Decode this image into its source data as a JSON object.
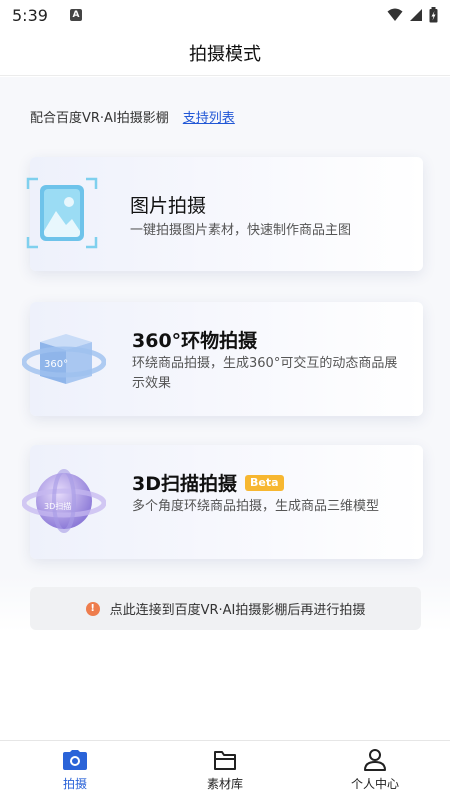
{
  "status_bar": {
    "time": "5:39",
    "notification_letter": "A"
  },
  "header": {
    "title": "拍摄模式"
  },
  "intro": {
    "text": "配合百度VR·AI拍摄影棚",
    "link": "支持列表"
  },
  "modes": [
    {
      "title": "图片拍摄",
      "desc": "一键拍摄图片素材，快速制作商品主图",
      "icon": "image-icon"
    },
    {
      "title": "360°环物拍摄",
      "desc": "环绕商品拍摄，生成360°可交互的动态商品展示效果",
      "icon": "cube-360-icon",
      "icon_label": "360°"
    },
    {
      "title": "3D扫描拍摄",
      "badge": "Beta",
      "desc": "多个角度环绕商品拍摄，生成商品三维模型",
      "icon": "sphere-3d-icon",
      "icon_label": "3D扫描"
    }
  ],
  "notice": {
    "text": "点此连接到百度VR·AI拍摄影棚后再进行拍摄",
    "icon": "warning-icon"
  },
  "tabs": [
    {
      "label": "拍摄",
      "icon": "camera-icon",
      "active": true
    },
    {
      "label": "素材库",
      "icon": "folder-icon",
      "active": false
    },
    {
      "label": "个人中心",
      "icon": "person-icon",
      "active": false
    }
  ],
  "colors": {
    "accent": "#2a63d8",
    "link": "#2157d6",
    "badge": "#f7b731",
    "warning": "#ee7d4d"
  }
}
